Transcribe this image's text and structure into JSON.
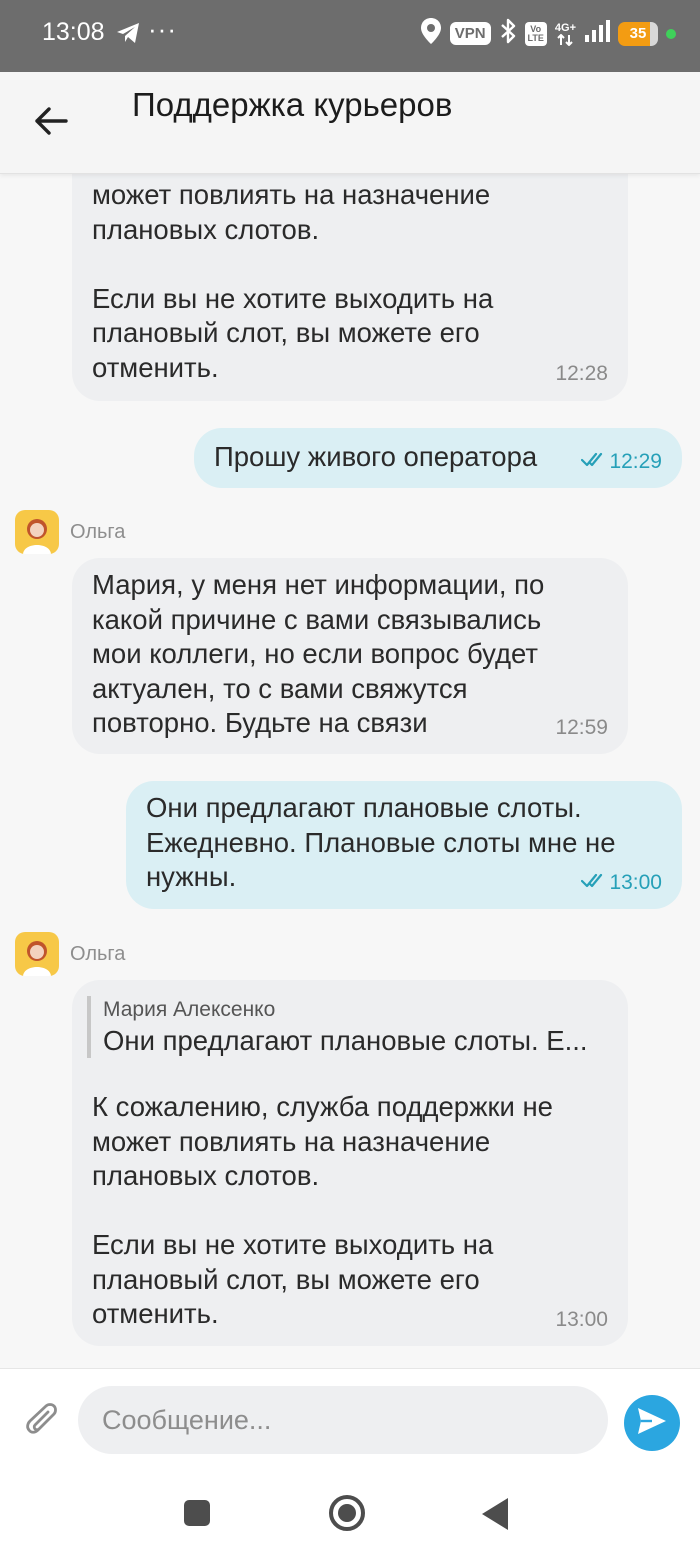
{
  "status_bar": {
    "time": "13:08",
    "overflow": "···",
    "vpn": "VPN",
    "volte_top": "Vo",
    "volte_bottom": "LTE",
    "network": "4G+",
    "battery": "35"
  },
  "header": {
    "title": "Поддержка курьеров"
  },
  "messages": [
    {
      "direction": "in",
      "text": "может повлиять на назначение\nплановых слотов.\n\nЕсли вы не хотите выходить на\nплановый слот, вы можете его\nотменить.",
      "time": "12:28"
    },
    {
      "direction": "out",
      "text": "Прошу живого оператора",
      "time": "12:29"
    },
    {
      "direction": "in",
      "sender": "Ольга",
      "text": "Мария, у меня нет информации, по\nкакой причине с вами связывались\nмои коллеги, но если вопрос будет\nактуален, то с вами свяжутся\nповторно. Будьте на связи",
      "time": "12:59"
    },
    {
      "direction": "out",
      "text": "Они предлагают плановые слоты.\nЕжедневно. Плановые слоты мне не\nнужны.",
      "time": "13:00"
    },
    {
      "direction": "in",
      "sender": "Ольга",
      "quote_name": "Мария Алексенко",
      "quote_text": "Они предлагают плановые слоты. Е...",
      "text": "К сожалению, служба поддержки не\nможет повлиять на назначение\nплановых слотов.\n\nЕсли вы не хотите выходить на\nплановый слот, вы можете его\nотменить.",
      "time": "13:00"
    }
  ],
  "composer": {
    "placeholder": "Сообщение..."
  },
  "colors": {
    "incoming_bubble": "#eeeff1",
    "outgoing_bubble": "#daeff4",
    "read_check": "#26a0b8",
    "send_button": "#2ba6e0",
    "avatar_bg": "#f7c847"
  },
  "icons": {
    "back": "arrow-left-icon",
    "attach": "paperclip-icon",
    "send": "paper-plane-icon",
    "read": "double-check-icon",
    "telegram": "telegram-icon",
    "location": "location-pin-icon",
    "bluetooth": "bluetooth-icon",
    "signal": "signal-bars-icon"
  }
}
